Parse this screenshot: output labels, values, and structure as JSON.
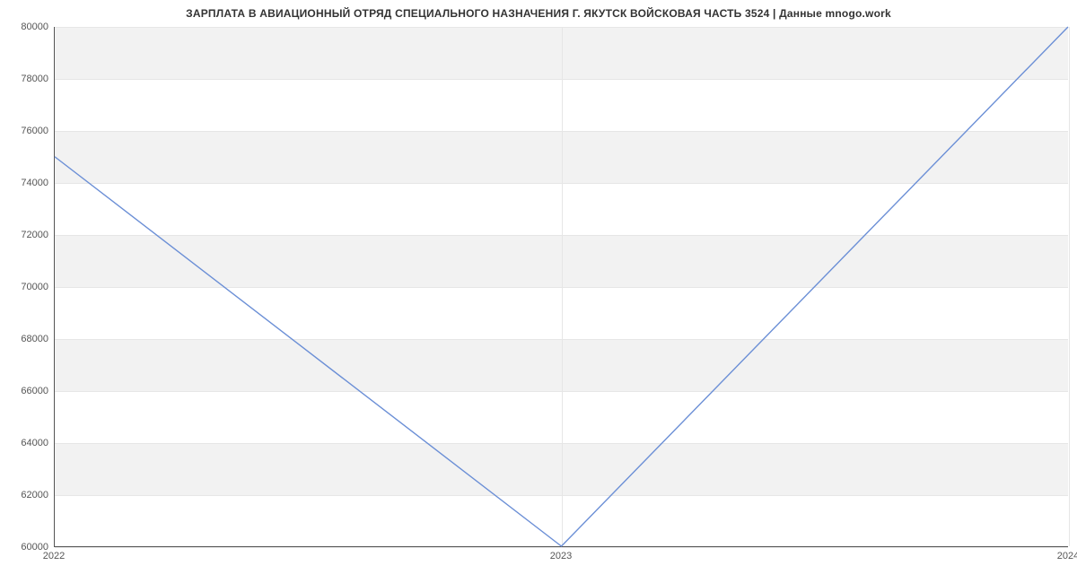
{
  "chart_data": {
    "type": "line",
    "title": "ЗАРПЛАТА В АВИАЦИОННЫЙ ОТРЯД СПЕЦИАЛЬНОГО НАЗНАЧЕНИЯ Г. ЯКУТСК ВОЙСКОВАЯ ЧАСТЬ 3524 | Данные mnogo.work",
    "x": [
      2022,
      2023,
      2024
    ],
    "values": [
      75000,
      60000,
      80000
    ],
    "xlabel": "",
    "ylabel": "",
    "xlim": [
      2022,
      2024
    ],
    "ylim": [
      60000,
      80000
    ],
    "x_ticks": [
      2022,
      2023,
      2024
    ],
    "y_ticks": [
      60000,
      62000,
      64000,
      66000,
      68000,
      70000,
      72000,
      74000,
      76000,
      78000,
      80000
    ],
    "line_color": "#6b8fd6"
  }
}
